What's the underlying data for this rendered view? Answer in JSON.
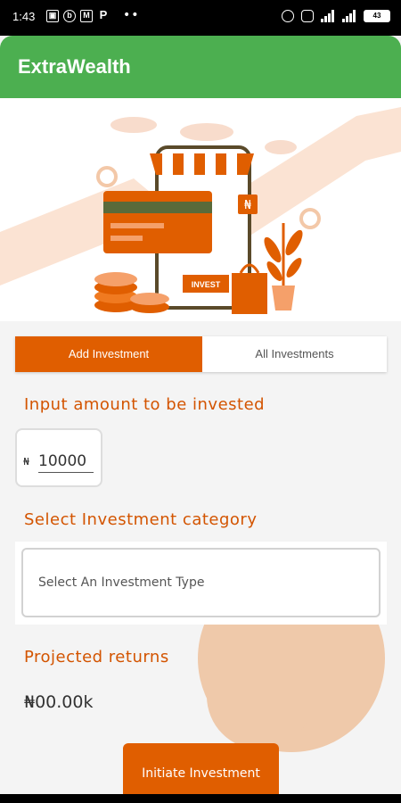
{
  "status_bar": {
    "time": "1:43",
    "left_icons": [
      "image-icon",
      "b-circle-icon",
      "mail-icon",
      "p-icon"
    ],
    "left_icon_glyphs": [
      "▣",
      "b",
      "M",
      "P"
    ],
    "dots": "••",
    "battery": "43"
  },
  "app": {
    "title": "ExtraWealth",
    "bar_color": "#4caf50"
  },
  "hero": {
    "sign_text": "INVEST",
    "currency_badge": "₦"
  },
  "tabs": [
    {
      "label": "Add Investment",
      "active": true
    },
    {
      "label": "All Investments",
      "active": false
    }
  ],
  "amount": {
    "label": "Input amount to be invested",
    "currency_symbol": "₦",
    "value": "10000"
  },
  "category": {
    "label": "Select Investment category",
    "selected": "Select An Investment Type"
  },
  "returns": {
    "label": "Projected returns",
    "value": "₦00.00k"
  },
  "cta": {
    "label": "Initiate Investment"
  },
  "colors": {
    "accent": "#e05e00",
    "label_color": "#d35400",
    "blob": "#efc9aa"
  }
}
